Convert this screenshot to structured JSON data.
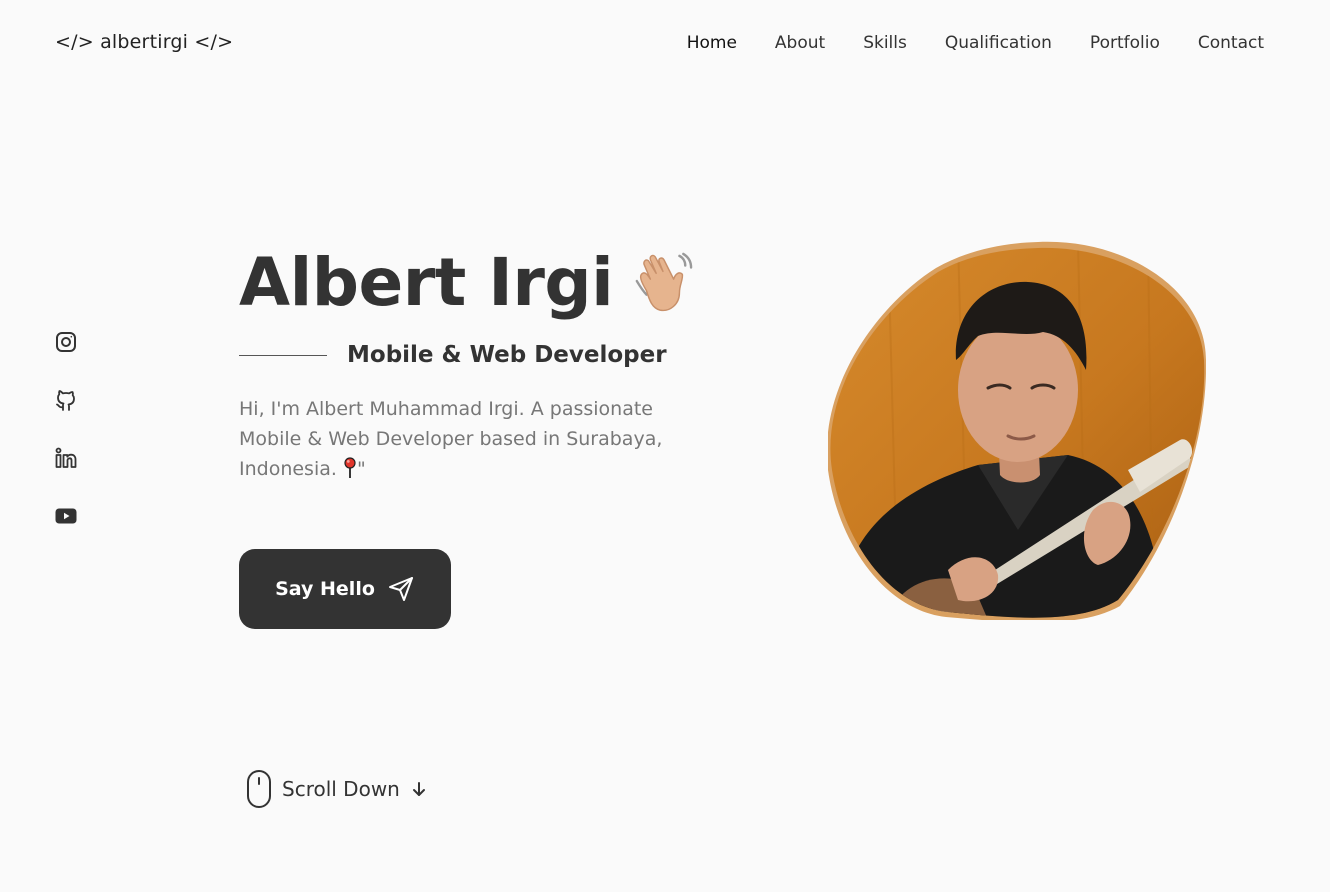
{
  "header": {
    "logo": "</> albertirgi </>",
    "nav": [
      {
        "label": "Home",
        "active": true
      },
      {
        "label": "About"
      },
      {
        "label": "Skills"
      },
      {
        "label": "Qualification"
      },
      {
        "label": "Portfolio"
      },
      {
        "label": "Contact"
      }
    ]
  },
  "social": [
    {
      "icon": "instagram-icon"
    },
    {
      "icon": "github-icon"
    },
    {
      "icon": "linkedin-icon"
    },
    {
      "icon": "youtube-icon"
    }
  ],
  "hero": {
    "name": "Albert Irgi",
    "wave_icon": "waving-hand-icon",
    "role": "Mobile & Web Developer",
    "description": "Hi, I'm Albert Muhammad Irgi. A passionate Mobile & Web Developer based in Surabaya, Indonesia.",
    "description_suffix": "\"",
    "pin_icon": "round-pushpin-icon",
    "cta_label": "Say Hello",
    "cta_icon": "send-icon",
    "photo_alt": "Albert Irgi playing ukulele"
  },
  "scroll": {
    "label": "Scroll Down",
    "mouse_icon": "mouse-icon",
    "arrow_icon": "arrow-down-icon"
  },
  "colors": {
    "background": "#fafafa",
    "text": "#333333",
    "muted": "#777777",
    "button": "#333333",
    "blob_border": "#d9a060",
    "photo_bg": "#c7781f"
  }
}
